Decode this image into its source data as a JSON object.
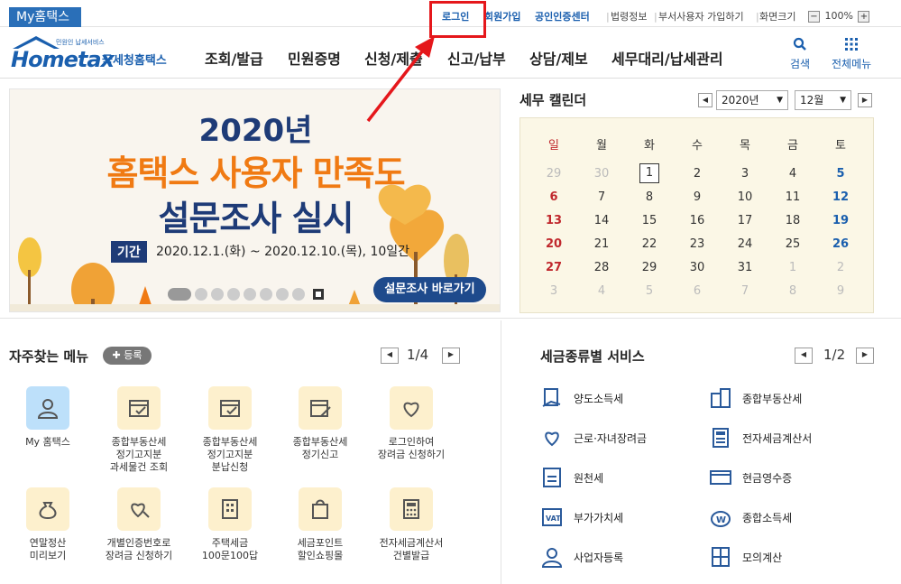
{
  "topbar": {
    "my_hometax": "My홈택스",
    "links": [
      {
        "label": "로그인",
        "style": "blue"
      },
      {
        "label": "회원가입",
        "style": "blue"
      },
      {
        "label": "공인인증센터",
        "style": "blue"
      },
      {
        "label": "법령정보",
        "style": "gray"
      },
      {
        "label": "부서사용자 가입하기",
        "style": "gray"
      },
      {
        "label": "화면크기",
        "style": "gray"
      }
    ],
    "zoom_value": "100%",
    "zoom_minus": "−",
    "zoom_plus": "+"
  },
  "header": {
    "logo_small": "민원인 납세서비스",
    "logo_main": "Hometax",
    "logo_sub": "국세청홈택스",
    "nav": [
      "조회/발급",
      "민원증명",
      "신청/제출",
      "신고/납부",
      "상담/제보",
      "세무대리/납세관리"
    ],
    "search_label": "검색",
    "menu_label": "전체메뉴"
  },
  "banner": {
    "year": "2020년",
    "title": "홈택스 사용자 만족도",
    "title2": "설문조사 실시",
    "period_tag": "기간",
    "period": "2020.12.1.(화) ~ 2020.12.10.(목), 10일간",
    "go_button": "설문조사 바로가기"
  },
  "calendar": {
    "title": "세무 캘린더",
    "year": "2020년",
    "month": "12월",
    "weekdays": [
      "일",
      "월",
      "화",
      "수",
      "목",
      "금",
      "토"
    ],
    "weeks": [
      [
        "29",
        "30",
        "1",
        "2",
        "3",
        "4",
        "5"
      ],
      [
        "6",
        "7",
        "8",
        "9",
        "10",
        "11",
        "12"
      ],
      [
        "13",
        "14",
        "15",
        "16",
        "17",
        "18",
        "19"
      ],
      [
        "20",
        "21",
        "22",
        "23",
        "24",
        "25",
        "26"
      ],
      [
        "27",
        "28",
        "29",
        "30",
        "31",
        "1",
        "2"
      ],
      [
        "3",
        "4",
        "5",
        "6",
        "7",
        "8",
        "9"
      ]
    ],
    "today": "1",
    "colors": {
      "sunday": "#c0282d",
      "saturday": "#1a5fae",
      "muted": "#bbbbbb"
    }
  },
  "quick_menu": {
    "title": "자주찾는 메뉴",
    "add_label": "등록",
    "pager": "1/4",
    "items": [
      {
        "label": "My 홈택스",
        "icon": "person-icon"
      },
      {
        "label": "종합부동산세\n정기고지분\n과세물건 조회",
        "icon": "calendar-check-icon"
      },
      {
        "label": "종합부동산세\n정기고지분\n분납신청",
        "icon": "calendar-check-icon"
      },
      {
        "label": "종합부동산세\n정기신고",
        "icon": "calendar-pen-icon"
      },
      {
        "label": "로그인하여\n장려금 신청하기",
        "icon": "heart-pen-icon"
      },
      {
        "label": "연말정산\n미리보기",
        "icon": "money-bag-icon"
      },
      {
        "label": "개별인증번호로\n장려금 신청하기",
        "icon": "heart-key-icon"
      },
      {
        "label": "주택세금\n100문100답",
        "icon": "building-icon"
      },
      {
        "label": "세금포인트\n할인쇼핑몰",
        "icon": "shopping-bag-icon"
      },
      {
        "label": "전자세금계산서\n건별발급",
        "icon": "calculator-icon"
      }
    ]
  },
  "tax_services": {
    "title": "세금종류별 서비스",
    "pager": "1/2",
    "items": [
      {
        "label": "양도소득세",
        "icon": "document-hand-icon"
      },
      {
        "label": "종합부동산세",
        "icon": "buildings-icon"
      },
      {
        "label": "근로·자녀장려금",
        "icon": "heart-hand-icon"
      },
      {
        "label": "전자세금계산서",
        "icon": "calculator-icon"
      },
      {
        "label": "원천세",
        "icon": "salary-icon"
      },
      {
        "label": "현금영수증",
        "icon": "receipt-icon"
      },
      {
        "label": "부가가치세",
        "icon": "vat-icon"
      },
      {
        "label": "종합소득세",
        "icon": "won-bag-icon"
      },
      {
        "label": "사업자등록",
        "icon": "person-icon"
      },
      {
        "label": "모의계산",
        "icon": "calc-icon"
      }
    ]
  },
  "colors": {
    "brand": "#1a5fae",
    "accent": "#f07a13",
    "highlight": "#e5171b"
  }
}
